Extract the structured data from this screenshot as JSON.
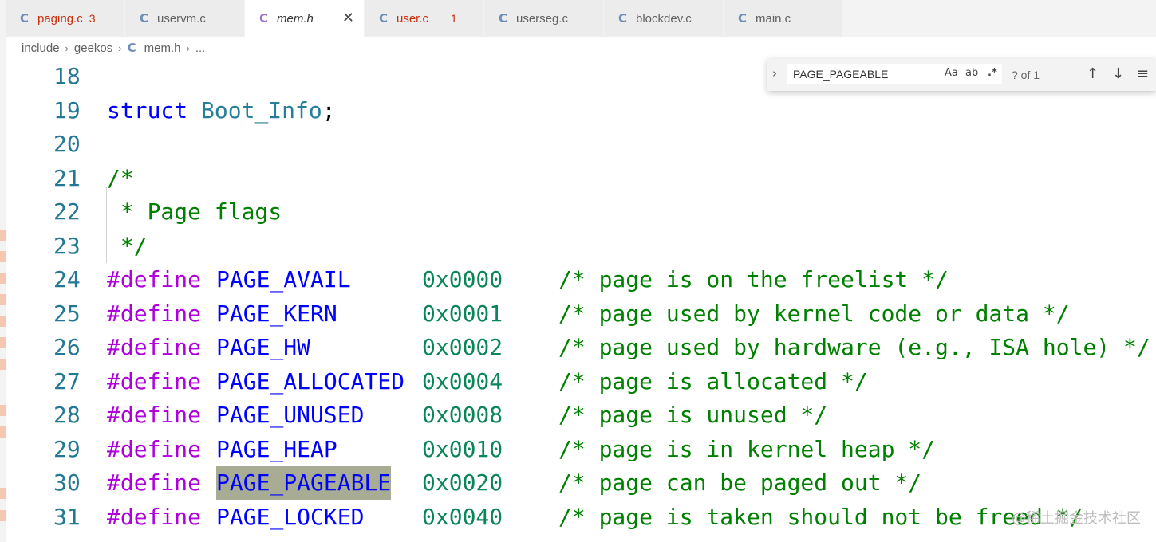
{
  "tabs": [
    {
      "icon": "C",
      "label": "paging.c",
      "count": "3",
      "state": "error"
    },
    {
      "icon": "C",
      "label": "uservm.c",
      "count": "",
      "state": "normal"
    },
    {
      "icon": "C",
      "label": "mem.h",
      "count": "",
      "state": "active",
      "close": "✕"
    },
    {
      "icon": "C",
      "label": "user.c",
      "count": "1",
      "state": "error"
    },
    {
      "icon": "C",
      "label": "userseg.c",
      "count": "",
      "state": "normal"
    },
    {
      "icon": "C",
      "label": "blockdev.c",
      "count": "",
      "state": "normal"
    },
    {
      "icon": "C",
      "label": "main.c",
      "count": "",
      "state": "normal"
    }
  ],
  "breadcrumb": {
    "items": [
      "include",
      "geekos",
      "mem.h",
      "..."
    ],
    "file_icon": "C",
    "separator": "›"
  },
  "find": {
    "toggle": "›",
    "value": "PAGE_PAGEABLE",
    "match_case": "Aa",
    "whole_word": "ab",
    "regex": ".*",
    "result": "? of 1",
    "prev": "↑",
    "next": "↓",
    "selection": "≡"
  },
  "editor": {
    "lines": [
      {
        "n": "18"
      },
      {
        "n": "19",
        "kw": "struct",
        "type": "Boot_Info",
        "punct": ";"
      },
      {
        "n": "20"
      },
      {
        "n": "21",
        "comment": "/*"
      },
      {
        "n": "22",
        "comment": " * Page flags"
      },
      {
        "n": "23",
        "comment": " */"
      },
      {
        "n": "24",
        "define": "#define",
        "name": "PAGE_AVAIL",
        "value": "0x0000",
        "comment": "/* page is on the freelist */"
      },
      {
        "n": "25",
        "define": "#define",
        "name": "PAGE_KERN",
        "value": "0x0001",
        "comment": "/* page used by kernel code or data */"
      },
      {
        "n": "26",
        "define": "#define",
        "name": "PAGE_HW",
        "value": "0x0002",
        "comment": "/* page used by hardware (e.g., ISA hole) */"
      },
      {
        "n": "27",
        "define": "#define",
        "name": "PAGE_ALLOCATED",
        "value": "0x0004",
        "comment": "/* page is allocated */"
      },
      {
        "n": "28",
        "define": "#define",
        "name": "PAGE_UNUSED",
        "value": "0x0008",
        "comment": "/* page is unused */"
      },
      {
        "n": "29",
        "define": "#define",
        "name": "PAGE_HEAP",
        "value": "0x0010",
        "comment": "/* page is in kernel heap */"
      },
      {
        "n": "30",
        "define": "#define",
        "name": "PAGE_PAGEABLE",
        "value": "0x0020",
        "comment": "/* page can be paged out */",
        "highlight": true
      },
      {
        "n": "31",
        "define": "#define",
        "name": "PAGE_LOCKED",
        "value": "0x0040",
        "comment": "/* page is taken should not be freed */"
      }
    ]
  },
  "watermark": "@稀土掘金技术社区",
  "colors": {
    "keyword": "#0000ff",
    "preprocessor": "#af00db",
    "number": "#098658",
    "comment": "#008000",
    "type": "#267f99",
    "line_number": "#237893",
    "match_highlight": "#a8ac94",
    "error_tab": "#c72e0f"
  }
}
